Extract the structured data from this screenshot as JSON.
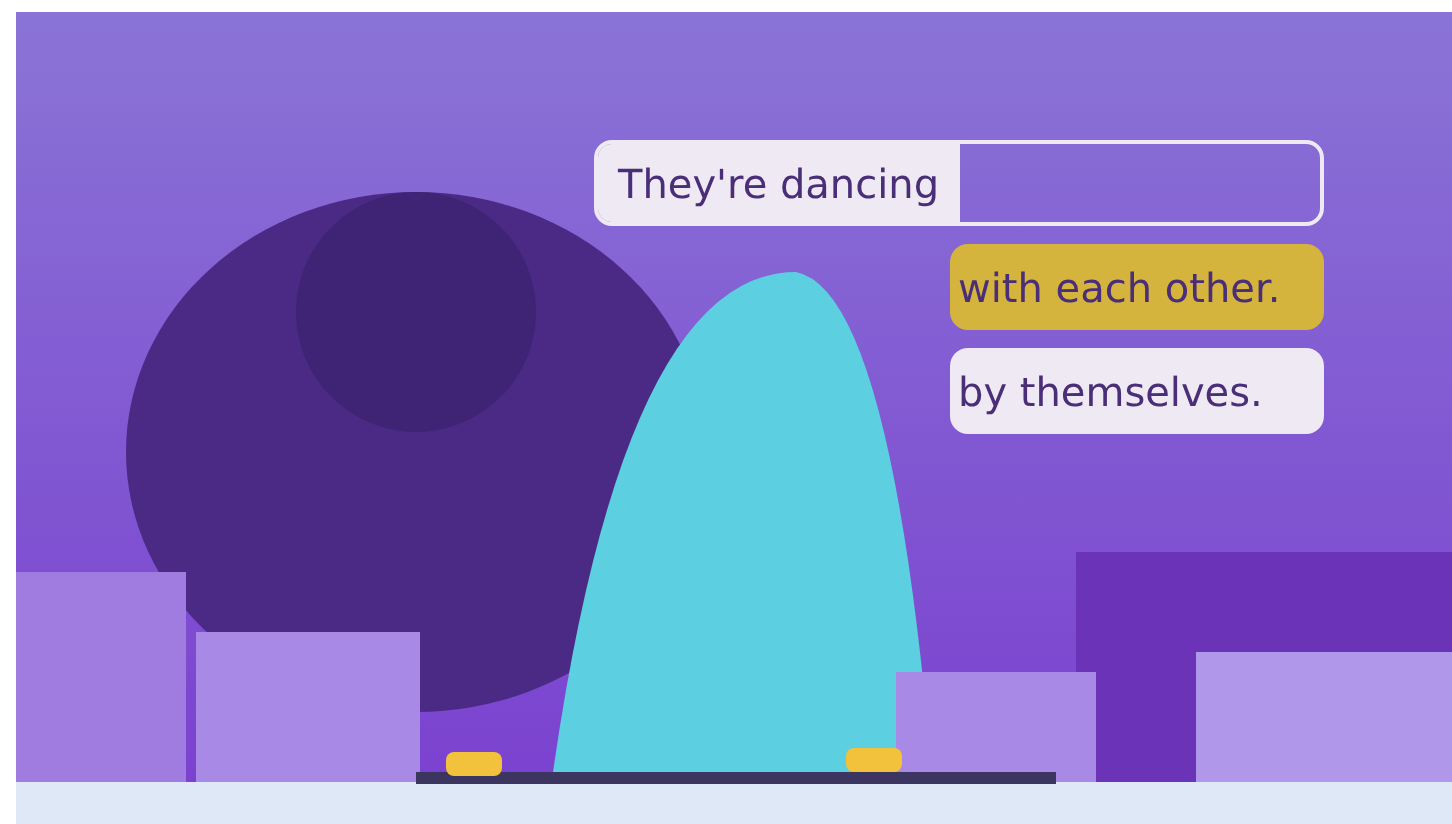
{
  "sentence": {
    "text": "They're dancing"
  },
  "options": [
    {
      "label": "with each other.",
      "selected": true
    },
    {
      "label": "by themselves.",
      "selected": false
    }
  ]
}
